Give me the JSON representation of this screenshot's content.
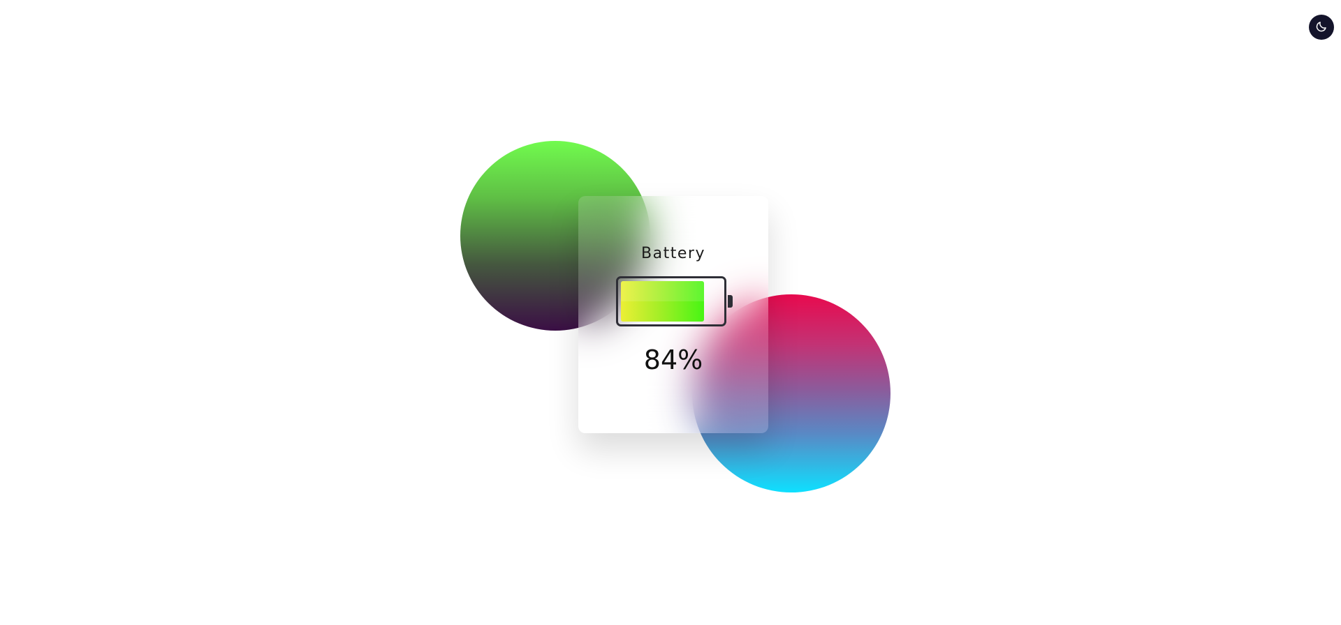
{
  "card": {
    "title": "Battery",
    "percent_label": "84%"
  },
  "battery": {
    "level_fraction": 0.84,
    "fill_colors": [
      "#ecef35",
      "#a6ee27",
      "#47f514"
    ]
  },
  "theme_toggle": {
    "icon": "moon-icon",
    "background": "#14142b"
  },
  "background_circles": {
    "green_gradient": [
      "#71fb4e",
      "#45583f",
      "#3b0f45"
    ],
    "pink_blue_gradient": [
      "#e80a4e",
      "#8c5b9b",
      "#0ee0ff"
    ]
  }
}
